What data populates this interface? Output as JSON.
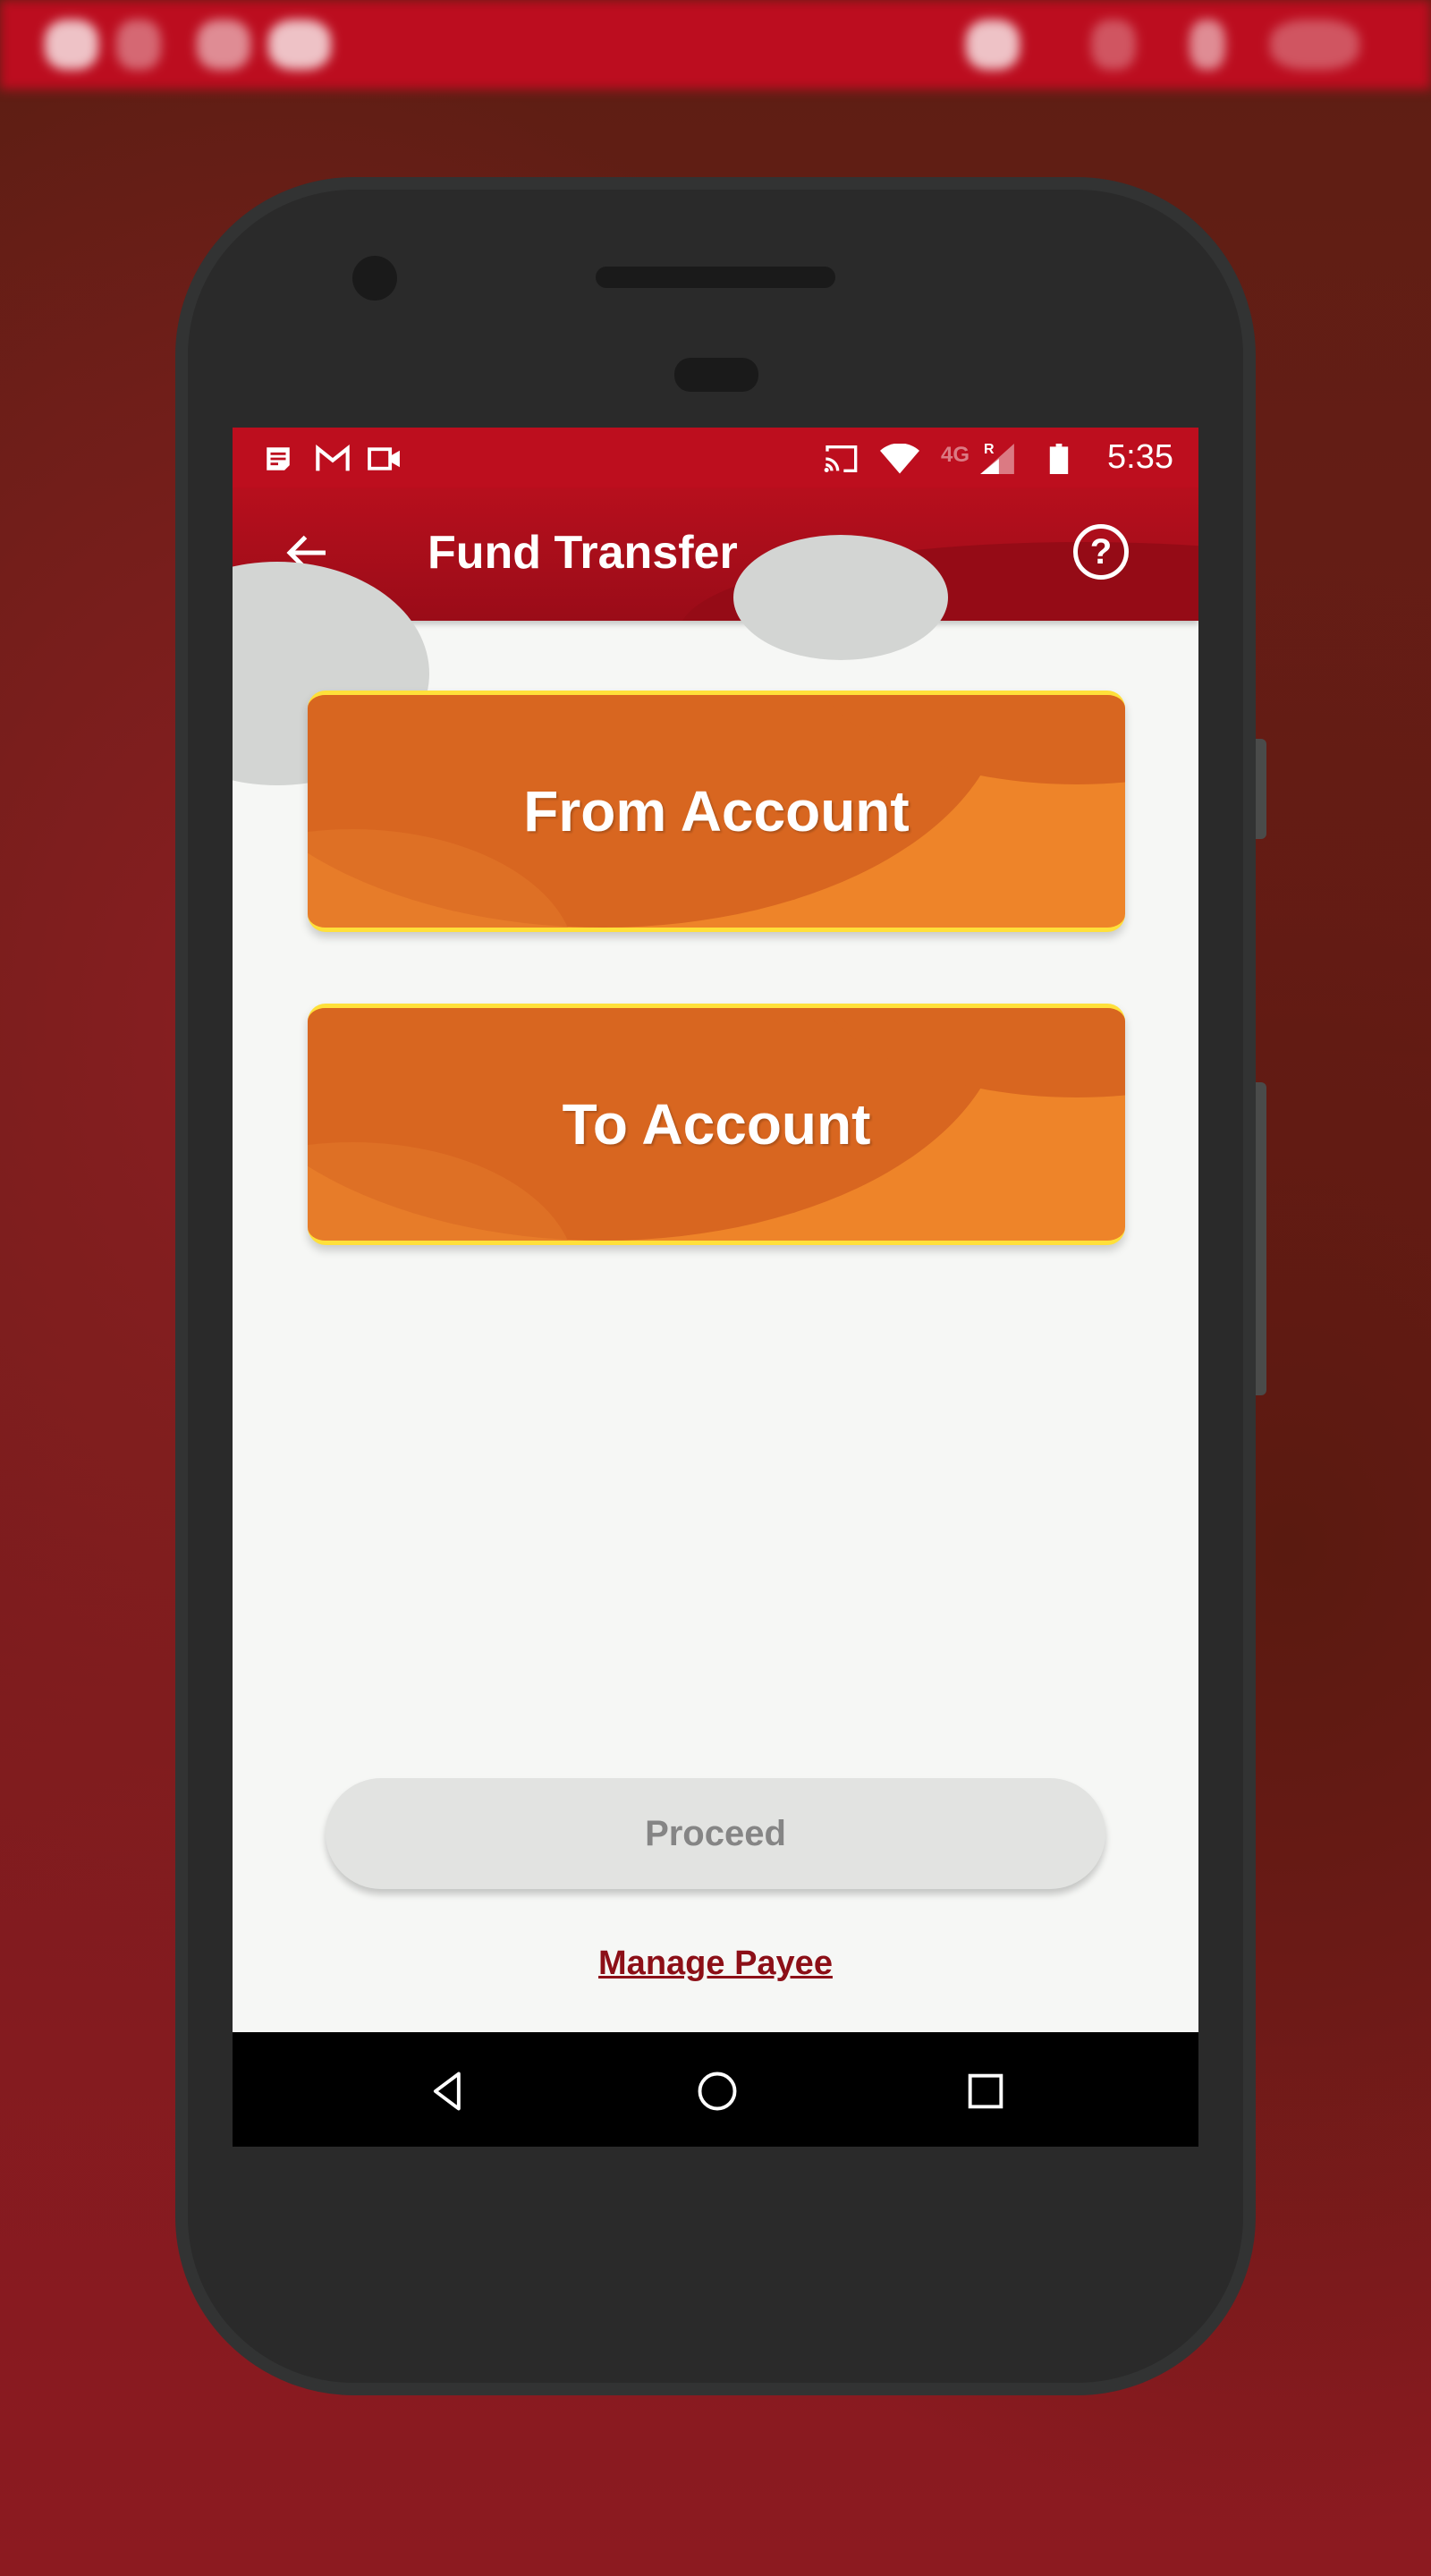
{
  "outer_status": {
    "time": "5:40"
  },
  "status_bar": {
    "left_icons": [
      "notification-icon",
      "gmail-icon",
      "video-icon"
    ],
    "right_icons": [
      "cast-icon",
      "wifi-icon",
      "signal-4g-roaming-icon",
      "battery-icon"
    ],
    "network_label": "4G",
    "roaming_label": "R",
    "time": "5:35"
  },
  "app_bar": {
    "title": "Fund Transfer",
    "back_icon": "arrow-left-icon",
    "help_icon": "help-circle-icon",
    "help_glyph": "?"
  },
  "cards": {
    "from_account": "From Account",
    "to_account": "To Account"
  },
  "actions": {
    "proceed": "Proceed",
    "manage_payee": "Manage Payee"
  },
  "nav_bar": {
    "buttons": [
      "back",
      "home",
      "recents"
    ]
  },
  "colors": {
    "brand_red": "#bd0e1e",
    "card_orange": "#ee8429",
    "card_border": "#ffe03a",
    "link_red": "#8c0f17",
    "disabled_button": "#e2e3e1"
  }
}
